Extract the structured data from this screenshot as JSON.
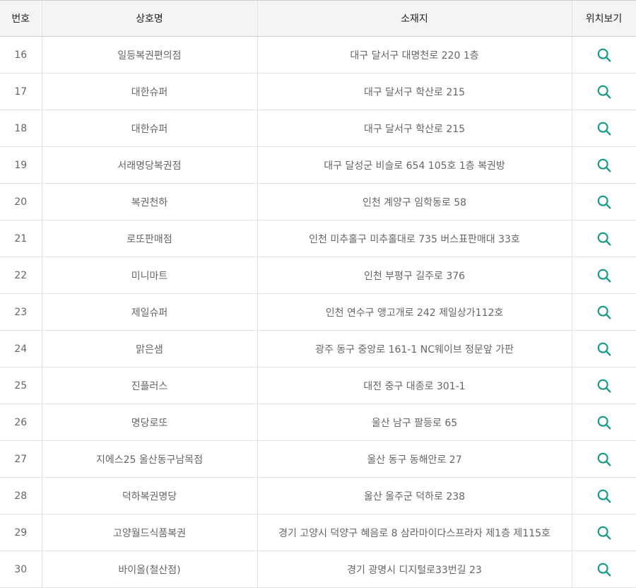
{
  "table": {
    "headers": {
      "no": "번호",
      "name": "상호명",
      "address": "소재지",
      "location": "위치보기"
    },
    "rows": [
      {
        "no": "16",
        "name": "일등복권편의점",
        "address": "대구 달서구 대명천로 220 1층"
      },
      {
        "no": "17",
        "name": "대한슈퍼",
        "address": "대구 달서구 학산로 215"
      },
      {
        "no": "18",
        "name": "대한슈퍼",
        "address": "대구 달서구 학산로 215"
      },
      {
        "no": "19",
        "name": "서래명당복권점",
        "address": "대구 달성군 비슬로 654 105호 1층 복권방"
      },
      {
        "no": "20",
        "name": "복권천하",
        "address": "인천 계양구 임학동로 58"
      },
      {
        "no": "21",
        "name": "로또판매점",
        "address": "인천 미추홀구 미추홀대로 735 버스표판매대 33호"
      },
      {
        "no": "22",
        "name": "미니마트",
        "address": "인천 부평구 길주로 376"
      },
      {
        "no": "23",
        "name": "제일슈퍼",
        "address": "인천 연수구 앵고개로 242 제일상가112호"
      },
      {
        "no": "24",
        "name": "맑은샘",
        "address": "광주 동구 중앙로 161-1 NC웨이브 정문앞 가판"
      },
      {
        "no": "25",
        "name": "진플러스",
        "address": "대전 중구 대종로 301-1"
      },
      {
        "no": "26",
        "name": "명당로또",
        "address": "울산 남구 팔등로 65"
      },
      {
        "no": "27",
        "name": "지에스25 울산동구남목점",
        "address": "울산 동구 동해안로 27"
      },
      {
        "no": "28",
        "name": "덕하복권명당",
        "address": "울산 울주군 덕하로 238"
      },
      {
        "no": "29",
        "name": "고양월드식품복권",
        "address": "경기 고양시 덕양구 혜음로 8 삼라마이다스프라자 제1층 제115호"
      },
      {
        "no": "30",
        "name": "바이올(철산점)",
        "address": "경기 광명시 디지털로33번길 23"
      }
    ],
    "location_icon": "search-icon",
    "icon_color": "#1a9a8a"
  }
}
